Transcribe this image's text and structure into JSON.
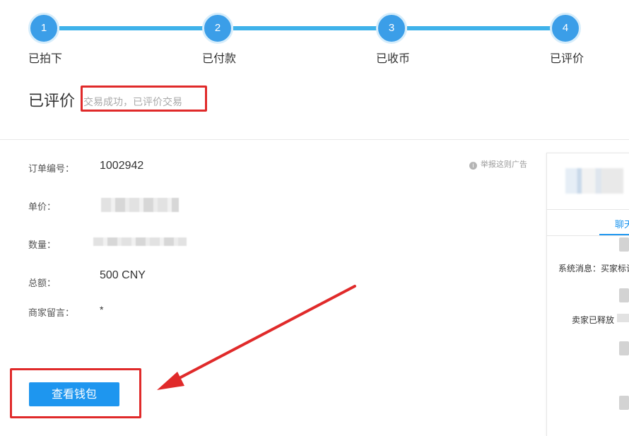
{
  "steps": [
    {
      "number": "1",
      "label": "已拍下"
    },
    {
      "number": "2",
      "label": "已付款"
    },
    {
      "number": "3",
      "label": "已收币"
    },
    {
      "number": "4",
      "label": "已评价"
    }
  ],
  "status": {
    "title": "已评价",
    "subtitle": "交易成功，已评价交易"
  },
  "order": {
    "id_label": "订单编号：",
    "id_value": "1002942",
    "unit_price_label": "单价：",
    "quantity_label": "数量：",
    "total_label": "总额：",
    "total_value": "500 CNY",
    "merchant_note_label": "商家留言：",
    "merchant_note_value": "*"
  },
  "report_ad": "举报这则广告",
  "wallet_button": "查看钱包",
  "chat": {
    "tab_label": "聊天",
    "system_message": "系统消息：买家标记",
    "seller_message": "卖家已释放"
  },
  "colors": {
    "accent": "#1e96ef",
    "step_circle": "#3b9ee8",
    "step_line": "#3fb2ea",
    "annotation": "#e02a2a"
  }
}
